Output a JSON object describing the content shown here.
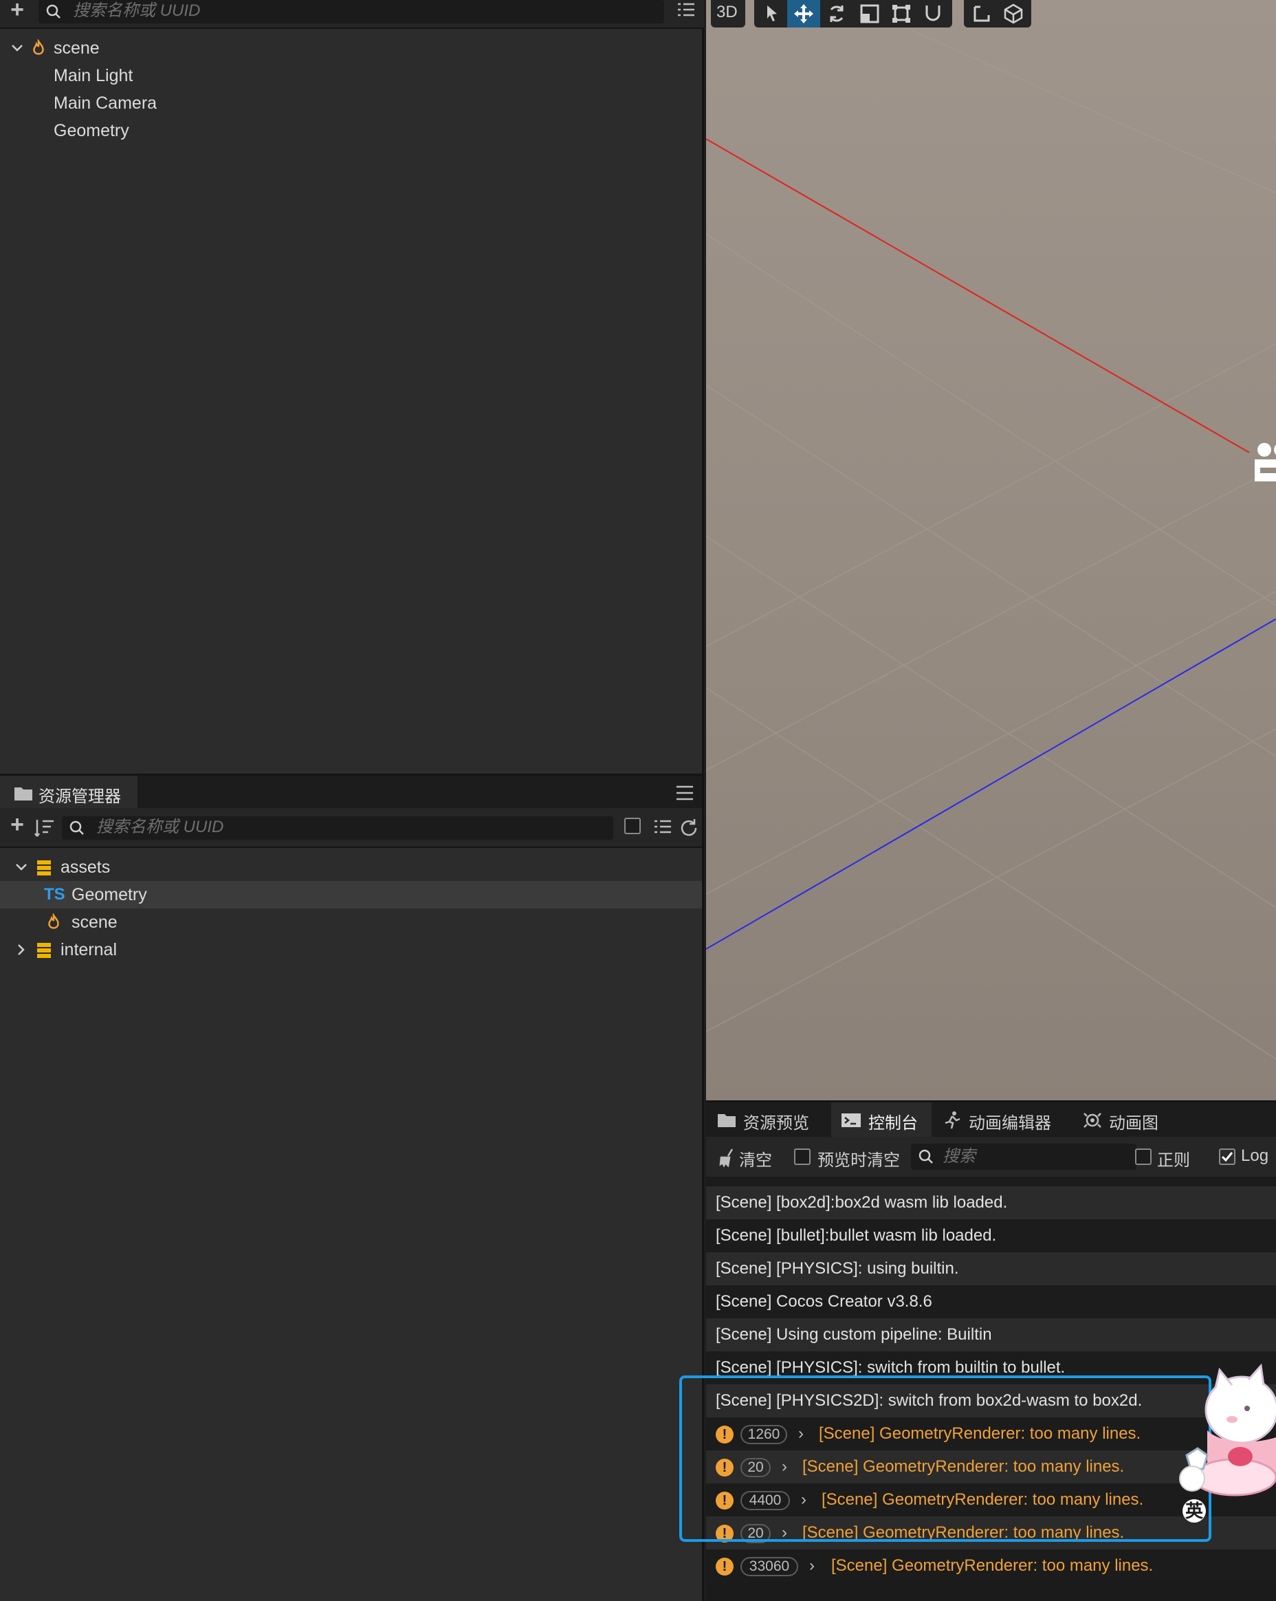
{
  "hierarchy": {
    "search_placeholder": "搜索名称或 UUID",
    "nodes": [
      {
        "label": "scene"
      },
      {
        "label": "Main Light"
      },
      {
        "label": "Main Camera"
      },
      {
        "label": "Geometry"
      }
    ]
  },
  "assets": {
    "tab_label": "资源管理器",
    "search_placeholder": "搜索名称或 UUID",
    "items": [
      {
        "label": "assets",
        "icon": "folder-db-icon"
      },
      {
        "label": "Geometry",
        "icon": "ts-file-icon",
        "badge": "TS"
      },
      {
        "label": "scene",
        "icon": "scene-icon"
      },
      {
        "label": "internal",
        "icon": "folder-db-icon"
      }
    ]
  },
  "viewport": {
    "mode_label": "3D",
    "colors": {
      "x_axis": "#e0241f",
      "z_axis": "#2a2ae8"
    }
  },
  "console": {
    "tabs": [
      {
        "label": "资源预览"
      },
      {
        "label": "控制台"
      },
      {
        "label": "动画编辑器"
      },
      {
        "label": "动画图"
      }
    ],
    "toolbar": {
      "clear_label": "清空",
      "clear_on_preview_label": "预览时清空",
      "search_placeholder": "搜索",
      "regex_label": "正则",
      "log_label": "Log"
    },
    "logs": [
      {
        "text": "[Scene] [box2d]:box2d wasm lib loaded."
      },
      {
        "text": "[Scene] [bullet]:bullet wasm lib loaded."
      },
      {
        "text": "[Scene] [PHYSICS]: using builtin."
      },
      {
        "text": "[Scene] Cocos Creator v3.8.6"
      },
      {
        "text": "[Scene] Using custom pipeline: Builtin"
      },
      {
        "text": "[Scene] [PHYSICS]: switch from builtin to bullet."
      },
      {
        "text": "[Scene] [PHYSICS2D]: switch from box2d-wasm to box2d."
      }
    ],
    "warnings": [
      {
        "count": "1260",
        "text": "[Scene] GeometryRenderer: too many lines."
      },
      {
        "count": "20",
        "text": "[Scene] GeometryRenderer: too many lines."
      },
      {
        "count": "4400",
        "text": "[Scene] GeometryRenderer: too many lines."
      },
      {
        "count": "20",
        "text": "[Scene] GeometryRenderer: too many lines."
      },
      {
        "count": "33060",
        "text": "[Scene] GeometryRenderer: too many lines."
      }
    ],
    "warning_color": "#f0a136",
    "highlight_color": "#1b9be8"
  },
  "ime_badge": "英"
}
